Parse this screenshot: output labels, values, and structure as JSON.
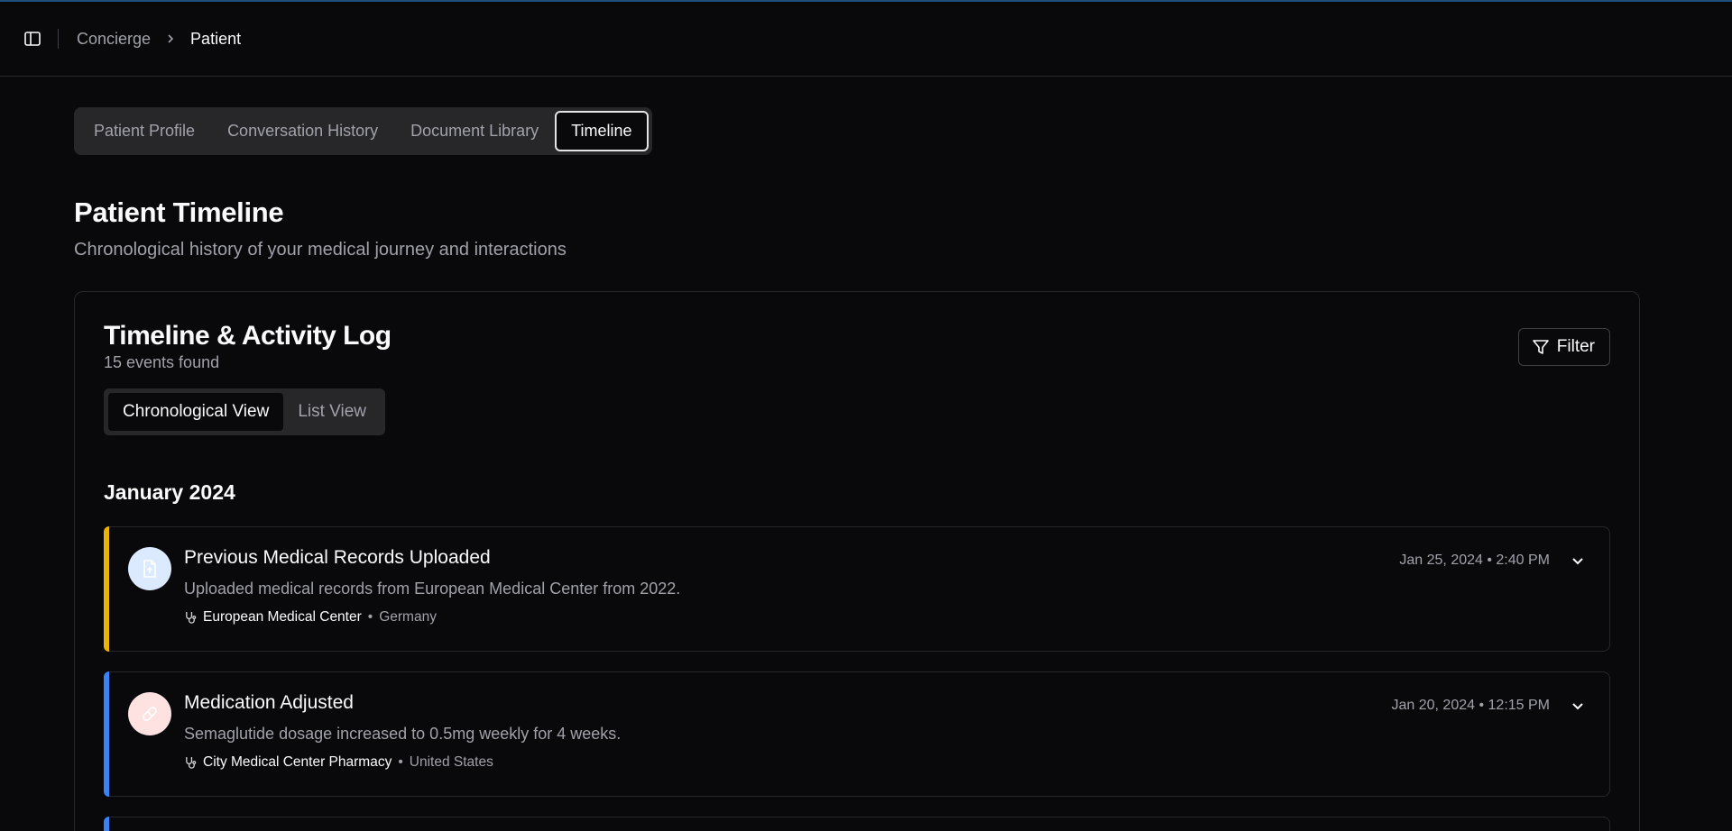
{
  "breadcrumb": {
    "parent": "Concierge",
    "current": "Patient"
  },
  "tabs": [
    {
      "label": "Patient Profile",
      "active": false
    },
    {
      "label": "Conversation History",
      "active": false
    },
    {
      "label": "Document Library",
      "active": false
    },
    {
      "label": "Timeline",
      "active": true
    }
  ],
  "page": {
    "title": "Patient Timeline",
    "subtitle": "Chronological history of your medical journey and interactions"
  },
  "card": {
    "title": "Timeline & Activity Log",
    "count": "15 events found",
    "filter_label": "Filter",
    "views": [
      {
        "label": "Chronological View",
        "active": true
      },
      {
        "label": "List View",
        "active": false
      }
    ],
    "month": "January 2024"
  },
  "events": [
    {
      "title": "Previous Medical Records Uploaded",
      "description": "Uploaded medical records from European Medical Center from 2022.",
      "location": "European Medical Center",
      "country": "Germany",
      "datetime": "Jan 25, 2024 • 2:40 PM",
      "accent": "#eab308",
      "icon": "file-upload-icon",
      "icon_bg": "#dbeafe",
      "icon_fg": "#bfdbfe"
    },
    {
      "title": "Medication Adjusted",
      "description": "Semaglutide dosage increased to 0.5mg weekly for 4 weeks.",
      "location": "City Medical Center Pharmacy",
      "country": "United States",
      "datetime": "Jan 20, 2024 • 12:15 PM",
      "accent": "#3b82f6",
      "icon": "pill-icon",
      "icon_bg": "#fee2e2",
      "icon_fg": "#fecaca"
    },
    {
      "accent": "#3b82f6"
    }
  ],
  "colors": {
    "background": "#09090b",
    "border": "#27272a",
    "muted_text": "#a1a1aa"
  }
}
